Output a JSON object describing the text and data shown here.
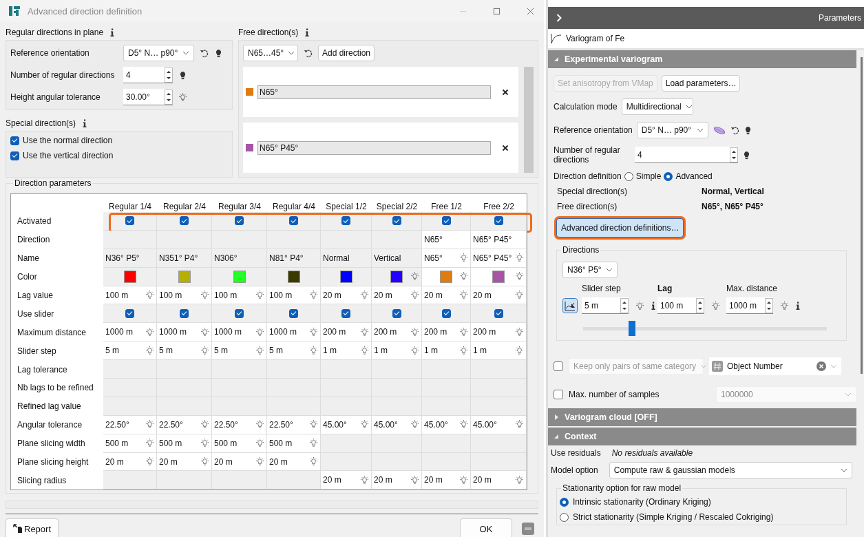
{
  "dialog": {
    "title": "Advanced direction definition",
    "regular": {
      "heading": "Regular directions in plane",
      "fields": [
        {
          "label": "Reference orientation",
          "kind": "combo",
          "value": "D5° N… p90°",
          "pinned": true
        },
        {
          "label": "Number of regular directions",
          "kind": "spin",
          "value": "4",
          "pinned": true
        },
        {
          "label": "Height angular tolerance",
          "kind": "spin",
          "value": "30.00°",
          "pinned": false
        }
      ]
    },
    "special": {
      "heading": "Special direction(s)",
      "options": [
        {
          "label": "Use the normal direction",
          "checked": true
        },
        {
          "label": "Use the vertical direction",
          "checked": true
        }
      ]
    },
    "free": {
      "heading": "Free direction(s)",
      "selector": "N65…45°",
      "add_button": "Add direction",
      "directions": [
        {
          "name": "N65°",
          "color": "#e07b10"
        },
        {
          "name": "N65° P45°",
          "color": "#a855a8"
        }
      ]
    },
    "parameters": {
      "heading": "Direction parameters",
      "columns": [
        "Regular 1/4",
        "Regular 2/4",
        "Regular 3/4",
        "Regular 4/4",
        "Special 1/2",
        "Special 2/2",
        "Free 1/2",
        "Free 2/2"
      ],
      "rows": [
        {
          "label": "Activated",
          "kind": "check",
          "highlighted": true,
          "cells": [
            {
              "checked": true
            },
            {
              "checked": true
            },
            {
              "checked": true
            },
            {
              "checked": true
            },
            {
              "checked": true
            },
            {
              "checked": true
            },
            {
              "checked": true
            },
            {
              "checked": true
            }
          ]
        },
        {
          "label": "Direction",
          "kind": "text",
          "highlighted": false,
          "cells": [
            {
              "editable": false
            },
            {
              "editable": false
            },
            {
              "editable": false
            },
            {
              "editable": false
            },
            {
              "editable": false
            },
            {
              "editable": false
            },
            {
              "text": "N65°",
              "editable": true,
              "bulb": false
            },
            {
              "text": "N65° P45°",
              "editable": true,
              "bulb": false
            }
          ]
        },
        {
          "label": "Name",
          "kind": "text",
          "highlighted": false,
          "cells": [
            {
              "text": "N36° P5°",
              "editable": false,
              "bulb": false
            },
            {
              "text": "N351° P4°",
              "editable": false,
              "bulb": false
            },
            {
              "text": "N306°",
              "editable": false,
              "bulb": false
            },
            {
              "text": "N81° P4°",
              "editable": false,
              "bulb": false
            },
            {
              "text": "Normal",
              "editable": false,
              "bulb": false
            },
            {
              "text": "Vertical",
              "editable": false,
              "bulb": false
            },
            {
              "text": "N65°",
              "editable": true,
              "bulb": true
            },
            {
              "text": "N65° P45°",
              "editable": true,
              "bulb": true
            }
          ]
        },
        {
          "label": "Color",
          "kind": "swatch",
          "highlighted": false,
          "cells": [
            {
              "color": "#ff0000",
              "editable": false,
              "bulb": false
            },
            {
              "color": "#b5b000",
              "editable": false,
              "bulb": false
            },
            {
              "color": "#22ff22",
              "editable": false,
              "bulb": false
            },
            {
              "color": "#3a3a00",
              "editable": false,
              "bulb": false
            },
            {
              "color": "#0000ff",
              "editable": false,
              "bulb": false
            },
            {
              "color": "#2200ff",
              "editable": false,
              "bulb": true
            },
            {
              "color": "#e07b10",
              "editable": true,
              "bulb": true
            },
            {
              "color": "#a855a8",
              "editable": true,
              "bulb": true
            }
          ]
        },
        {
          "label": "Lag value",
          "kind": "text",
          "highlighted": false,
          "cells": [
            {
              "text": "100 m",
              "editable": true,
              "bulb": true
            },
            {
              "text": "100 m",
              "editable": true,
              "bulb": true
            },
            {
              "text": "100 m",
              "editable": true,
              "bulb": true
            },
            {
              "text": "100 m",
              "editable": true,
              "bulb": true
            },
            {
              "text": "20 m",
              "editable": true,
              "bulb": true
            },
            {
              "text": "20 m",
              "editable": true,
              "bulb": true
            },
            {
              "text": "20 m",
              "editable": true,
              "bulb": true
            },
            {
              "text": "20 m",
              "editable": true,
              "bulb": true
            }
          ]
        },
        {
          "label": "Use slider",
          "kind": "check",
          "highlighted": false,
          "cells": [
            {
              "checked": true
            },
            {
              "checked": true
            },
            {
              "checked": true
            },
            {
              "checked": true
            },
            {
              "checked": true
            },
            {
              "checked": true
            },
            {
              "checked": true
            },
            {
              "checked": true
            }
          ]
        },
        {
          "label": "Maximum distance",
          "kind": "text",
          "highlighted": false,
          "cells": [
            {
              "text": "1000 m",
              "editable": true,
              "bulb": true
            },
            {
              "text": "1000 m",
              "editable": true,
              "bulb": true
            },
            {
              "text": "1000 m",
              "editable": true,
              "bulb": true
            },
            {
              "text": "1000 m",
              "editable": true,
              "bulb": true
            },
            {
              "text": "200 m",
              "editable": true,
              "bulb": true
            },
            {
              "text": "200 m",
              "editable": true,
              "bulb": true
            },
            {
              "text": "200 m",
              "editable": true,
              "bulb": true
            },
            {
              "text": "200 m",
              "editable": true,
              "bulb": true
            }
          ]
        },
        {
          "label": "Slider step",
          "kind": "text",
          "highlighted": false,
          "cells": [
            {
              "text": "5 m",
              "editable": true,
              "bulb": true
            },
            {
              "text": "5 m",
              "editable": true,
              "bulb": true
            },
            {
              "text": "5 m",
              "editable": true,
              "bulb": true
            },
            {
              "text": "5 m",
              "editable": true,
              "bulb": true
            },
            {
              "text": "1 m",
              "editable": true,
              "bulb": true
            },
            {
              "text": "1 m",
              "editable": true,
              "bulb": true
            },
            {
              "text": "1 m",
              "editable": true,
              "bulb": true
            },
            {
              "text": "1 m",
              "editable": true,
              "bulb": true
            }
          ]
        },
        {
          "label": "Lag tolerance",
          "kind": "text",
          "highlighted": false,
          "cells": [
            {
              "editable": false
            },
            {
              "editable": false
            },
            {
              "editable": false
            },
            {
              "editable": false
            },
            {
              "editable": false
            },
            {
              "editable": false
            },
            {
              "editable": false
            },
            {
              "editable": false
            }
          ]
        },
        {
          "label": "Nb lags to be refined",
          "kind": "text",
          "highlighted": false,
          "cells": [
            {
              "editable": false
            },
            {
              "editable": false
            },
            {
              "editable": false
            },
            {
              "editable": false
            },
            {
              "editable": false
            },
            {
              "editable": false
            },
            {
              "editable": false
            },
            {
              "editable": false
            }
          ]
        },
        {
          "label": "Refined lag value",
          "kind": "text",
          "highlighted": false,
          "cells": [
            {
              "editable": false
            },
            {
              "editable": false
            },
            {
              "editable": false
            },
            {
              "editable": false
            },
            {
              "editable": false
            },
            {
              "editable": false
            },
            {
              "editable": false
            },
            {
              "editable": false
            }
          ]
        },
        {
          "label": "Angular tolerance",
          "kind": "text",
          "highlighted": false,
          "cells": [
            {
              "text": "22.50°",
              "editable": true,
              "bulb": true
            },
            {
              "text": "22.50°",
              "editable": true,
              "bulb": true
            },
            {
              "text": "22.50°",
              "editable": true,
              "bulb": true
            },
            {
              "text": "22.50°",
              "editable": true,
              "bulb": true
            },
            {
              "text": "45.00°",
              "editable": true,
              "bulb": true
            },
            {
              "text": "45.00°",
              "editable": true,
              "bulb": true
            },
            {
              "text": "45.00°",
              "editable": true,
              "bulb": true
            },
            {
              "text": "45.00°",
              "editable": true,
              "bulb": true
            }
          ]
        },
        {
          "label": "Plane slicing width",
          "kind": "text",
          "highlighted": false,
          "cells": [
            {
              "text": "500 m",
              "editable": true,
              "bulb": true
            },
            {
              "text": "500 m",
              "editable": true,
              "bulb": true
            },
            {
              "text": "500 m",
              "editable": true,
              "bulb": true
            },
            {
              "text": "500 m",
              "editable": true,
              "bulb": true
            },
            {
              "editable": false
            },
            {
              "editable": false
            },
            {
              "editable": false
            },
            {
              "editable": false
            }
          ]
        },
        {
          "label": "Plane slicing height",
          "kind": "text",
          "highlighted": false,
          "cells": [
            {
              "text": "20 m",
              "editable": true,
              "bulb": true
            },
            {
              "text": "20 m",
              "editable": true,
              "bulb": true
            },
            {
              "text": "20 m",
              "editable": true,
              "bulb": true
            },
            {
              "text": "20 m",
              "editable": true,
              "bulb": true
            },
            {
              "editable": false
            },
            {
              "editable": false
            },
            {
              "editable": false
            },
            {
              "editable": false
            }
          ]
        },
        {
          "label": "Slicing radius",
          "kind": "text",
          "highlighted": false,
          "cells": [
            {
              "editable": false
            },
            {
              "editable": false
            },
            {
              "editable": false
            },
            {
              "editable": false
            },
            {
              "text": "20 m",
              "editable": true,
              "bulb": true
            },
            {
              "text": "20 m",
              "editable": true,
              "bulb": true
            },
            {
              "text": "20 m",
              "editable": true,
              "bulb": true
            },
            {
              "text": "20 m",
              "editable": true,
              "bulb": true
            }
          ]
        }
      ]
    },
    "report_button": "Report",
    "ok_button": "OK"
  },
  "panel": {
    "title": "Parameters",
    "item": "Variogram of Fe",
    "experimental": {
      "title": "Experimental variogram",
      "expanded": true,
      "buttons": [
        {
          "label": "Set anisotropy from VMap",
          "disabled": true
        },
        {
          "label": "Load parameters…",
          "disabled": false
        }
      ],
      "calc_mode": {
        "label": "Calculation mode",
        "value": "Multidirectional"
      },
      "ref_orientation": {
        "label": "Reference orientation",
        "value": "D5° N… p90°"
      },
      "num_directions": {
        "label": "Number of regular directions",
        "value": "4"
      },
      "direction_definition": {
        "label": "Direction definition",
        "options": [
          {
            "label": "Simple",
            "selected": false
          },
          {
            "label": "Advanced",
            "selected": true
          }
        ]
      },
      "summary": [
        {
          "label": "Special direction(s)",
          "value": "Normal, Vertical"
        },
        {
          "label": "Free direction(s)",
          "value": "N65°, N65° P45°"
        }
      ],
      "advanced_button": {
        "label": "Advanced direction definitions…",
        "highlighted": true
      },
      "directions": {
        "heading": "Directions",
        "selector": "N36° P5°",
        "fields": [
          {
            "label": "Slider step",
            "value": "5 m",
            "bold": false,
            "info": true
          },
          {
            "label": "Lag",
            "value": "100 m",
            "bold": true,
            "info": false
          },
          {
            "label": "Max. distance",
            "value": "1000 m",
            "bold": false,
            "info": true
          }
        ],
        "slider": {
          "level": 0.2
        }
      },
      "same_category": {
        "label": "Keep only pairs of same category",
        "checked": false,
        "variable": "Object Number"
      },
      "max_samples": {
        "label": "Max. number of samples",
        "checked": false,
        "value": "1000000"
      }
    },
    "cloud": {
      "title": "Variogram cloud [OFF]",
      "expanded": false
    },
    "context": {
      "title": "Context",
      "expanded": true,
      "residuals": {
        "label": "Use residuals",
        "value": "No residuals available"
      },
      "model_option": {
        "label": "Model option",
        "value": "Compute raw & gaussian models"
      },
      "stationarity": {
        "heading": "Stationarity option for raw model",
        "options": [
          {
            "label": "Intrinsic stationarity (Ordinary Kriging)",
            "selected": true
          },
          {
            "label": "Strict stationarity (Simple Kriging / Rescaled Cokriging)",
            "selected": false
          }
        ]
      }
    }
  }
}
